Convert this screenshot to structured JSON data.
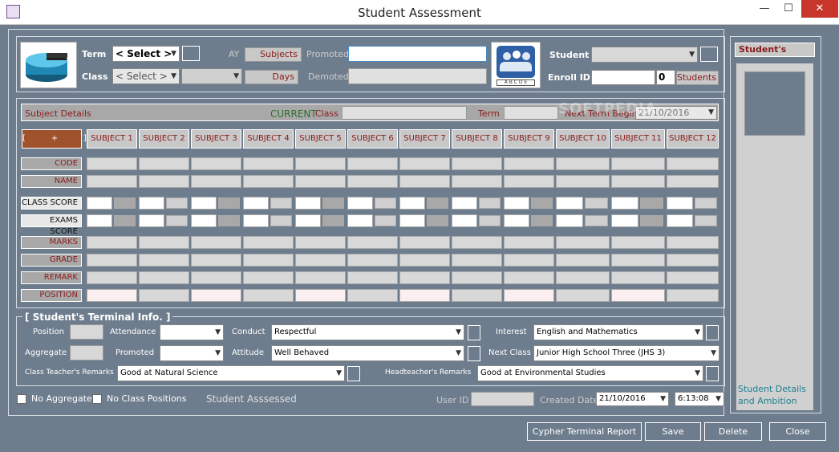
{
  "window": {
    "title": "Student Assessment",
    "min": "—",
    "max": "☐",
    "close": "✕"
  },
  "top": {
    "term_label": "Term",
    "class_label": "Class",
    "term_value": "< Select >",
    "class_value": "< Select >",
    "ay_label": "AY",
    "subjects_btn": "Subjects",
    "days_btn": "Days",
    "promoted_label": "Promoted",
    "demoted_label": "Demoted",
    "student_label": "Student",
    "enroll_label": "Enroll ID",
    "enroll_count": "0",
    "students_btn": "Students"
  },
  "details": {
    "subject_details": "Subject Details",
    "current": "CURRENT",
    "class": "Class",
    "term": "Term",
    "next_term": "Next Term Begins",
    "next_term_date": "21/10/2016",
    "add_btn": "[          +          ]"
  },
  "subjects": [
    "SUBJECT 1",
    "SUBJECT 2",
    "SUBJECT 3",
    "SUBJECT 4",
    "SUBJECT 5",
    "SUBJECT 6",
    "SUBJECT 7",
    "SUBJECT 8",
    "SUBJECT 9",
    "SUBJECT 10",
    "SUBJECT 11",
    "SUBJECT 12"
  ],
  "rows": {
    "code": "CODE",
    "name": "NAME",
    "class_score": "CLASS SCORE",
    "exams_score": "EXAMS SCORE",
    "marks": "MARKS",
    "grade": "GRADE",
    "remark": "REMARK",
    "position": "POSITION"
  },
  "terminal": {
    "legend": "[ Student's Terminal Info. ]",
    "position": "Position",
    "aggregate": "Aggregate",
    "attendance": "Attendance",
    "promoted": "Promoted",
    "conduct": "Conduct",
    "conduct_value": "Respectful",
    "attitude": "Attitude",
    "attitude_value": "Well Behaved",
    "interest": "Interest",
    "interest_value": "English and Mathematics",
    "next_class": "Next Class",
    "next_class_value": "Junior High School Three (JHS 3)",
    "ct_remarks": "Class Teacher's Remarks",
    "ct_remarks_value": "Good at Natural Science",
    "ht_remarks": "Headteacher's Remarks",
    "ht_remarks_value": "Good at Environmental Studies"
  },
  "footer": {
    "no_aggregate": "No Aggregate",
    "no_positions": "No Class Positions",
    "assessed": "Student Asssessed",
    "user_id": "User ID",
    "created_date": "Created Date",
    "created_date_value": "21/10/2016",
    "created_time": "6:13:08"
  },
  "side": {
    "header": "Student's",
    "caption": "Student Details and Ambition"
  },
  "buttons": {
    "cypher": "Cypher Terminal Report",
    "save": "Save",
    "delete": "Delete",
    "close": "Close"
  },
  "watermark": "SOFTPEDIA"
}
